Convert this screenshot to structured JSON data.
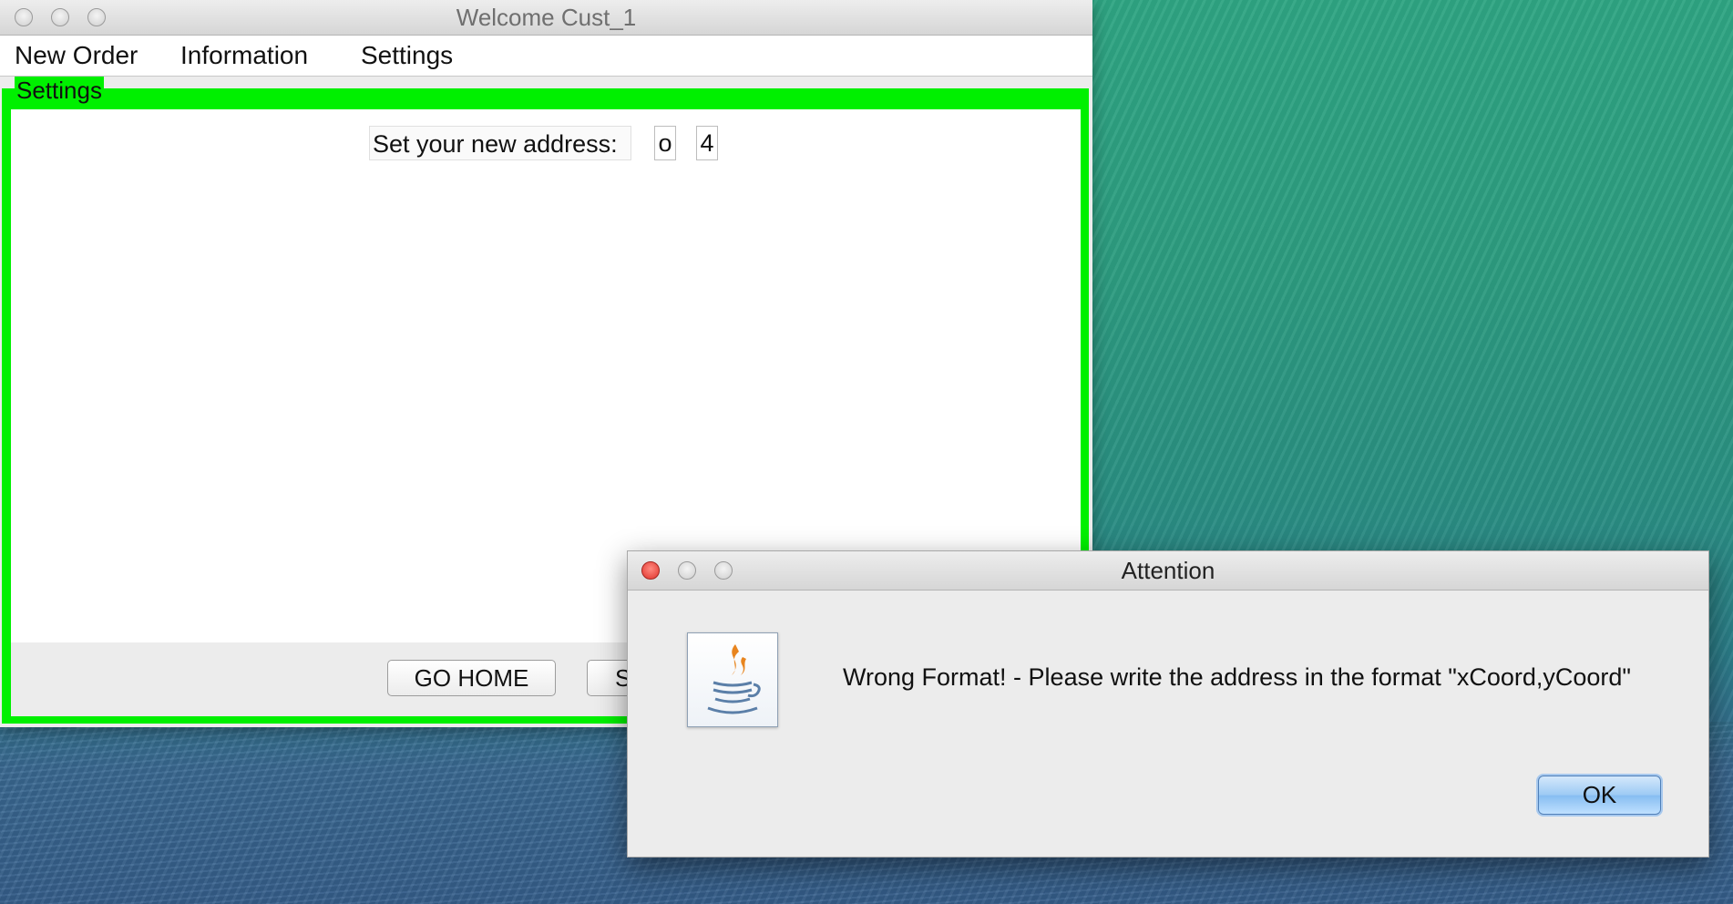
{
  "main_window": {
    "title": "Welcome Cust_1",
    "menu": [
      "New Order",
      "Information",
      "Settings"
    ],
    "group_title": "Settings",
    "address_label": "Set your new address:",
    "field_x_value": "o",
    "field_y_value": "4",
    "go_home_label": "GO HOME",
    "second_button_label_visible": "S"
  },
  "dialog": {
    "title": "Attention",
    "message": "Wrong Format! - Please write the address in the format \"xCoord,yCoord\"",
    "ok_label": "OK",
    "icon": "java-cup-icon"
  },
  "colors": {
    "group_border": "#00f000",
    "ok_button": "#9ccaf4",
    "close_button": "#e0322b"
  }
}
